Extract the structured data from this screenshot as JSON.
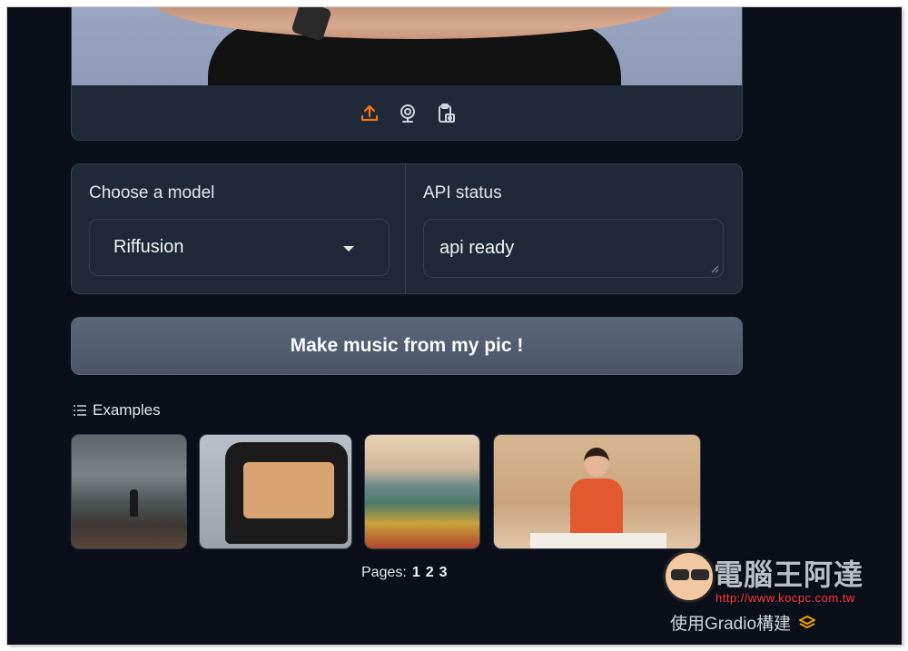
{
  "upload_panel": {
    "icons": [
      {
        "name": "upload-icon",
        "color": "#f97316"
      },
      {
        "name": "webcam-icon",
        "color": "#d1d5db"
      },
      {
        "name": "clipboard-image-icon",
        "color": "#d1d5db"
      }
    ]
  },
  "model": {
    "label": "Choose a model",
    "selected": "Riffusion"
  },
  "api": {
    "label": "API status",
    "value": "api ready"
  },
  "make_button": "Make music from my pic !",
  "examples": {
    "label": "Examples",
    "thumbnails": [
      "stormy-sea-figure",
      "car-cartoon",
      "mountain-landscape",
      "woman-at-table"
    ]
  },
  "pagination": {
    "label": "Pages:",
    "pages": [
      "1",
      "2",
      "3"
    ]
  },
  "watermark": {
    "title": "電腦王阿達",
    "url": "http://www.kocpc.com.tw"
  },
  "footer": {
    "built_with": "使用Gradio構建"
  },
  "colors": {
    "background": "#0b0f19",
    "panel": "#1f2937",
    "border": "#374151",
    "accent": "#f97316"
  }
}
